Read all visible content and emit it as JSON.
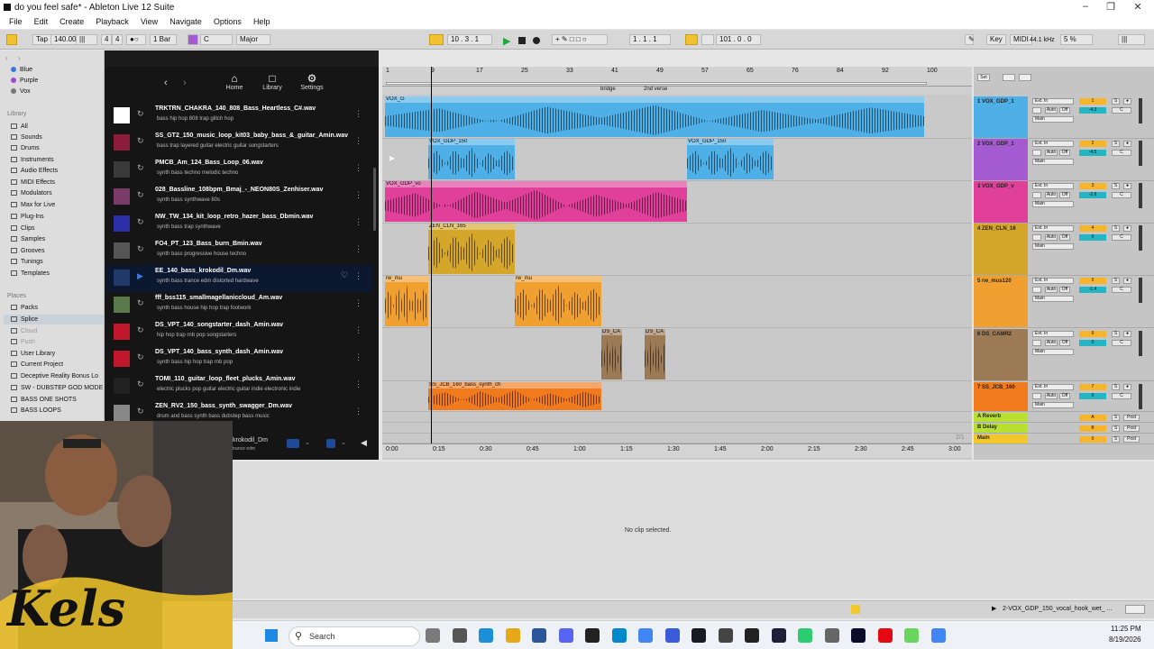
{
  "window": {
    "title": "do you feel safe* - Ableton Live 12 Suite"
  },
  "menu": [
    "File",
    "Edit",
    "Create",
    "Playback",
    "View",
    "Navigate",
    "Options",
    "Help"
  ],
  "transport": {
    "tap": "Tap",
    "tempo": "140.00",
    "signature_num": "4",
    "signature_den": "4",
    "quantize": "1 Bar",
    "key": "C",
    "scale": "Major",
    "position": "10 .  3 .  1",
    "loop_start": "1 .  1 .  1",
    "loop_length": "101 .  0 .  0",
    "key_label": "Key",
    "midi_label": "MIDI",
    "sample_rate": "44.1 kHz",
    "cpu": "5 %"
  },
  "sidebar": {
    "colors": [
      "Blue",
      "Purple",
      "Vox"
    ],
    "library_heading": "Library",
    "library": [
      "All",
      "Sounds",
      "Drums",
      "Instruments",
      "Audio Effects",
      "MIDI Effects",
      "Modulators",
      "Max for Live",
      "Plug-Ins",
      "Clips",
      "Samples",
      "Grooves",
      "Tunings",
      "Templates"
    ],
    "places_heading": "Places",
    "places": [
      "Packs",
      "Splice",
      "Cloud",
      "Push",
      "User Library",
      "Current Project",
      "Deceptive Reality Bonus Lo",
      "SW - DUBSTEP GOD MODE",
      "BASS ONE SHOTS",
      "BASS LOOPS"
    ]
  },
  "splice": {
    "nav": [
      {
        "label": "Home",
        "icon": "home-icon"
      },
      {
        "label": "Library",
        "icon": "folder-icon"
      },
      {
        "label": "Settings",
        "icon": "gear-icon"
      }
    ],
    "samples": [
      {
        "name": "TRKTRN_CHAKRA_140_808_Bass_Heartless_C#.wav",
        "tags": "bass   hip hop   808   trap   glitch hop",
        "color": "#ffffff"
      },
      {
        "name": "SS_GT2_150_music_loop_kit03_baby_bass_&_guitar_Amin.wav",
        "tags": "bass   trap   layered   guitar   electric guitar   songstarters",
        "color": "#8b1c3a"
      },
      {
        "name": "PMCB_Am_124_Bass_Loop_06.wav",
        "tags": "synth   bass   techno   melodic techno",
        "color": "#3a3a3a"
      },
      {
        "name": "028_Bassline_108bpm_Bmaj_-_NEON80S_Zenhiser.wav",
        "tags": "synth   bass   synthwave   80s",
        "color": "#7a3a6a"
      },
      {
        "name": "NW_TW_134_kit_loop_retro_hazer_bass_Dbmin.wav",
        "tags": "synth   bass   trap   synthwave",
        "color": "#2a2fa8"
      },
      {
        "name": "FO4_PT_123_Bass_burn_Bmin.wav",
        "tags": "synth   bass   progressive house   techno",
        "color": "#555555"
      },
      {
        "name": "EE_140_bass_krokodil_Dm.wav",
        "tags": "synth   bass   trance   edm   distorted   hardwave",
        "color": "#1f3a6a"
      },
      {
        "name": "fff_bss115_smallmagellaniccloud_Am.wav",
        "tags": "synth   bass   house   hip hop   trap   footwork",
        "color": "#5a7a4a"
      },
      {
        "name": "DS_VPT_140_songstarter_dash_Amin.wav",
        "tags": "hip hop   trap   rnb   pop   songstarters",
        "color": "#c0182a"
      },
      {
        "name": "DS_VPT_140_bass_synth_dash_Amin.wav",
        "tags": "synth   bass   hip hop   trap   rnb   pop",
        "color": "#c0182a"
      },
      {
        "name": "TOMI_110_guitar_loop_fleet_plucks_Amin.wav",
        "tags": "electric   plucks   pop   guitar   electric guitar   indie electronic   indie",
        "color": "#222222"
      },
      {
        "name": "ZEN_RV2_150_bass_synth_swagger_Dm.wav",
        "tags": "drum and bass   synth   bass   dubstep   bass music",
        "color": "#888888"
      }
    ],
    "player": {
      "name": "krokodil_Dm",
      "tags": "trance   edm"
    }
  },
  "arrangement": {
    "bar_numbers": [
      "1",
      "9",
      "17",
      "25",
      "33",
      "41",
      "49",
      "57",
      "65",
      "76",
      "84",
      "92",
      "100"
    ],
    "locators": [
      "bridge",
      "2nd verse"
    ],
    "time_ticks": [
      "0:00",
      "0:15",
      "0:30",
      "0:45",
      "1:00",
      "1:15",
      "1:30",
      "1:45",
      "2:00",
      "2:15",
      "2:30",
      "2:45",
      "3:00"
    ],
    "page_indicator": "2/1",
    "clip_labels": {
      "vox1": "VOX_G",
      "vox2": "VOX_GDP_150",
      "vox3": "VOX_GDP_vo",
      "zen": "ZEN_CLN_165",
      "rw": "rw_mu",
      "ds": "DS_CA",
      "ss": "SS_JCB_160_bass_synth_ch"
    }
  },
  "mixer": {
    "tracks": [
      {
        "name": "1 VOX_GDP_1",
        "num": "1",
        "vol": "-4.3",
        "color": "#4fb0e8"
      },
      {
        "name": "2 VOX_GDP_1",
        "num": "2",
        "vol": "-4.5",
        "color": "#a45ad0"
      },
      {
        "name": "3 VOX_GDP_v",
        "num": "3",
        "vol": "-2.9",
        "color": "#e0409a"
      },
      {
        "name": "4 ZEN_CLN_16",
        "num": "4",
        "vol": "0",
        "color": "#d4a62a"
      },
      {
        "name": "5 rw_mus120",
        "num": "5",
        "vol": "-1.4",
        "color": "#f0a030"
      },
      {
        "name": "6 DS_CAMR2",
        "num": "6",
        "vol": "0",
        "color": "#9c7a56"
      },
      {
        "name": "7 SS_JCB_160",
        "num": "7",
        "vol": "0",
        "color": "#f07a1c"
      }
    ],
    "returns": [
      {
        "name": "A Reverb",
        "letter": "A",
        "color": "#b8e030"
      },
      {
        "name": "B Delay",
        "letter": "B",
        "color": "#b8e030"
      },
      {
        "name": "Main",
        "letter": "0",
        "color": "#f2c72a"
      }
    ],
    "input_label": "Ext. In",
    "output_label": "Main",
    "auto": "Auto",
    "off": "Off",
    "half": "1/2",
    "post": "Post",
    "set": "Set"
  },
  "detail": {
    "message": "No clip selected."
  },
  "status": {
    "track_clip": "2-VOX_GDP_150_vocal_hook_wet_ ..."
  },
  "taskbar": {
    "search_placeholder": "Search",
    "time": "11:25 PM",
    "date": "8/19/2026"
  },
  "overlay": {
    "logo_text": "Kels"
  }
}
